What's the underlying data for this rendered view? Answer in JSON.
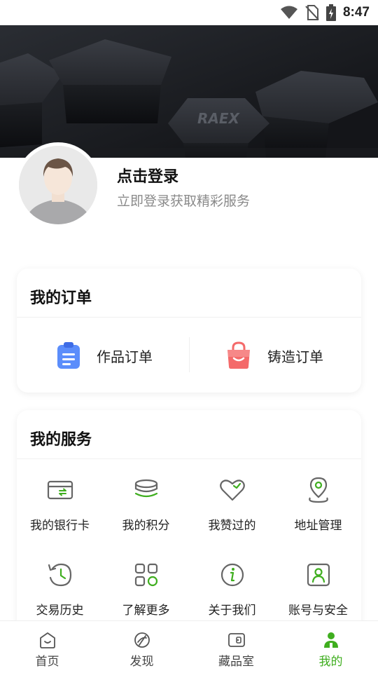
{
  "status_bar": {
    "time": "8:47"
  },
  "banner": {
    "logo_text": "RAEX"
  },
  "profile": {
    "login_title": "点击登录",
    "login_subtitle": "立即登录获取精彩服务"
  },
  "orders": {
    "title": "我的订单",
    "items": [
      {
        "label": "作品订单",
        "icon": "clipboard-icon",
        "color": "#5b8dfb"
      },
      {
        "label": "铸造订单",
        "icon": "shopping-bag-icon",
        "color": "#f46a6a"
      }
    ]
  },
  "services": {
    "title": "我的服务",
    "items": [
      {
        "label": "我的银行卡",
        "icon": "bank-card-icon"
      },
      {
        "label": "我的积分",
        "icon": "coins-icon"
      },
      {
        "label": "我赞过的",
        "icon": "heart-icon"
      },
      {
        "label": "地址管理",
        "icon": "location-pin-icon"
      },
      {
        "label": "交易历史",
        "icon": "history-clock-icon"
      },
      {
        "label": "了解更多",
        "icon": "grid-apps-icon"
      },
      {
        "label": "关于我们",
        "icon": "info-icon"
      },
      {
        "label": "账号与安全",
        "icon": "account-security-icon"
      }
    ]
  },
  "tabbar": {
    "items": [
      {
        "label": "首页",
        "icon": "home-icon",
        "active": false
      },
      {
        "label": "发现",
        "icon": "discover-icon",
        "active": false
      },
      {
        "label": "藏品室",
        "icon": "collection-icon",
        "active": false
      },
      {
        "label": "我的",
        "icon": "profile-icon",
        "active": true
      }
    ]
  },
  "colors": {
    "accent_green": "#3fae1f",
    "icon_gray": "#666666",
    "text_gray": "#8a8a8a"
  }
}
